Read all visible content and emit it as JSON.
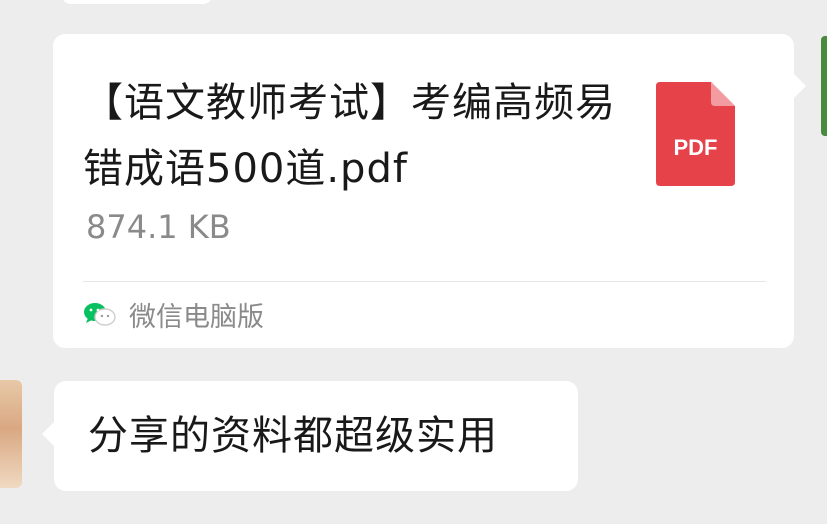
{
  "file_message": {
    "file_name": "【语文教师考试】考编高频易错成语500道.pdf",
    "file_size": "874.1 KB",
    "file_type_label": "PDF",
    "file_icon": "pdf-icon",
    "source_label": "微信电脑版",
    "source_icon": "wechat-icon"
  },
  "text_message": {
    "text": "分享的资料都超级实用"
  },
  "colors": {
    "chat_background": "#ededed",
    "bubble": "#ffffff",
    "pdf_red": "#e6424a",
    "pdf_fold": "#f29ba0",
    "secondary_text": "#8a8a8a",
    "wechat_green": "#07c160"
  }
}
